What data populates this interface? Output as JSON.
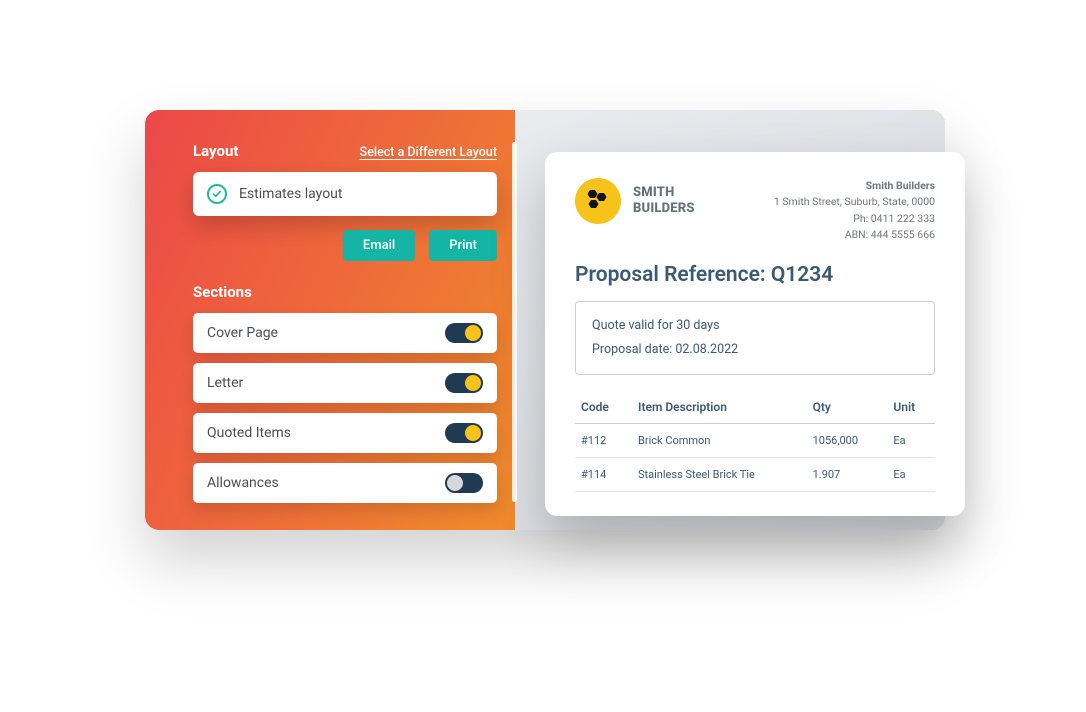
{
  "config": {
    "layout": {
      "title": "Layout",
      "change_link": "Select a Different Layout",
      "selected": "Estimates layout"
    },
    "actions": {
      "email": "Email",
      "print": "Print"
    },
    "sections": {
      "title": "Sections",
      "items": [
        {
          "label": "Cover Page",
          "on": true
        },
        {
          "label": "Letter",
          "on": true
        },
        {
          "label": "Quoted Items",
          "on": true
        },
        {
          "label": "Allowances",
          "on": false
        }
      ]
    }
  },
  "proposal": {
    "brand": {
      "line1": "SMITH",
      "line2": "BUILDERS"
    },
    "company": {
      "name": "Smith Builders",
      "address": "1 Smith Street, Suburb, State, 0000",
      "phone": "Ph: 0411 222 333",
      "abn": "ABN: 444 5555 666"
    },
    "title": "Proposal Reference: Q1234",
    "quote": {
      "validity": "Quote valid for 30 days",
      "date": "Proposal date: 02.08.2022"
    },
    "table": {
      "headers": {
        "code": "Code",
        "desc": "Item Description",
        "qty": "Qty",
        "unit": "Unit"
      },
      "rows": [
        {
          "code": "#112",
          "desc": "Brick Common",
          "qty": "1056,000",
          "unit": "Ea"
        },
        {
          "code": "#114",
          "desc": "Stainless Steel Brick Tie",
          "qty": "1.907",
          "unit": "Ea"
        }
      ]
    }
  }
}
